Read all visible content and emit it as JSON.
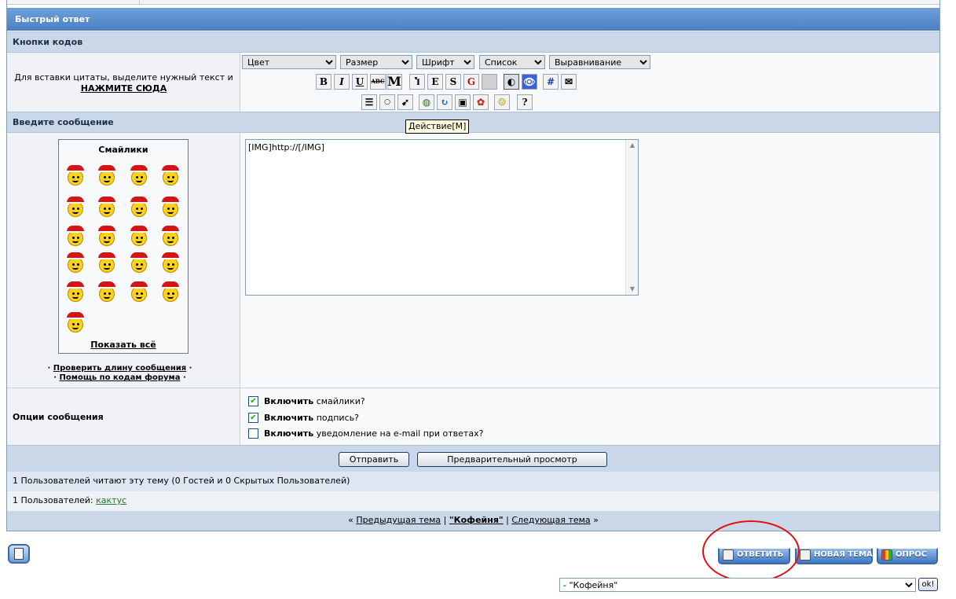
{
  "panel": {
    "title": "Быстрый ответ",
    "codes_header": "Кнопки кодов",
    "quote_hint": "Для вставки цитаты, выделите нужный текст и",
    "quote_link": "НАЖМИТЕ СЮДА",
    "message_header": "Введите сообщение",
    "options_label": "Опции сообщения"
  },
  "toolbar": {
    "dropdowns": [
      {
        "name": "color",
        "value": "Цвет"
      },
      {
        "name": "size",
        "value": "Размер"
      },
      {
        "name": "font",
        "value": "Шрифт"
      },
      {
        "name": "list",
        "value": "Список"
      },
      {
        "name": "align",
        "value": "Выравнивание"
      }
    ],
    "row1": [
      {
        "label": "B",
        "name": "bold-button"
      },
      {
        "label": "I",
        "name": "italic-button"
      },
      {
        "label": "U",
        "name": "underline-button"
      },
      {
        "label": "ABC",
        "name": "strike-button"
      },
      {
        "label": "M",
        "name": "mono-button"
      },
      {
        "label": "Ⴈ",
        "name": "spoiler-button"
      },
      {
        "label": "E",
        "name": "e-button"
      },
      {
        "label": "S",
        "name": "s-button"
      },
      {
        "label": "G",
        "name": "g-button"
      },
      {
        "label": "",
        "name": "blank-button"
      },
      {
        "label": "◐",
        "name": "sound-button"
      },
      {
        "label": "👁",
        "name": "eye-button"
      },
      {
        "label": "#",
        "name": "code-button"
      },
      {
        "label": "✉",
        "name": "quote-button"
      }
    ],
    "row2": [
      {
        "label": "☰",
        "name": "list-button"
      },
      {
        "label": "○",
        "name": "circle-button"
      },
      {
        "label": "➹",
        "name": "action-button"
      },
      {
        "label": "◍",
        "name": "link-button"
      },
      {
        "label": "↻",
        "name": "replace-button"
      },
      {
        "label": "▣",
        "name": "image-button"
      },
      {
        "label": "✿",
        "name": "color-wheel-button"
      },
      {
        "label": "☺",
        "name": "smiley-button"
      },
      {
        "label": "?",
        "name": "help-button"
      }
    ],
    "tooltip": "Действие[M]"
  },
  "smilies": {
    "title": "Смайлики",
    "show_all": "Показать всё",
    "count": 21
  },
  "links": {
    "check_length": "Проверить длину сообщения",
    "codes_help": "Помощь по кодам форума"
  },
  "message": {
    "value": "[IMG]http://[/IMG]"
  },
  "options": [
    {
      "bold": "Включить",
      "rest": " смайлики?",
      "checked": true
    },
    {
      "bold": "Включить",
      "rest": " подпись?",
      "checked": true
    },
    {
      "bold": "Включить",
      "rest": " уведомление на e-mail при ответах?",
      "checked": false
    }
  ],
  "buttons": {
    "submit": "Отправить",
    "preview": "Предварительный просмотр"
  },
  "status": {
    "readers": "1 Пользователей читают эту тему (0 Гостей и 0 Скрытых Пользователей)",
    "users_label": "1 Пользователей:",
    "user_name": "кактус"
  },
  "nav": {
    "prev": "Предыдущая тема",
    "current": "\"Кофейня\"",
    "next": "Следующая тема",
    "left_mark": "«",
    "right_mark": "»",
    "divider": "|"
  },
  "actions": {
    "reply": "ОТВЕТИТЬ",
    "new_topic": "НОВАЯ ТЕМА",
    "poll": "ОПРОС"
  },
  "forum_jump": {
    "value": " - \"Кофейня\"",
    "ok": "ok!"
  }
}
